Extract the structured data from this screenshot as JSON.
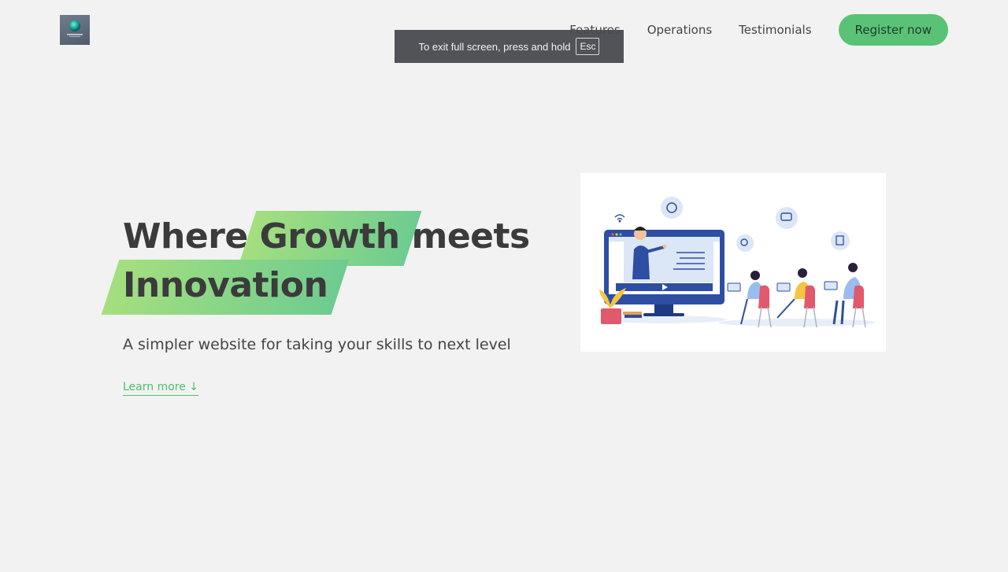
{
  "header": {
    "logo_icon": "globe-logo-icon",
    "nav": [
      {
        "label": "Features"
      },
      {
        "label": "Operations"
      },
      {
        "label": "Testimonials"
      }
    ],
    "register_label": "Register now"
  },
  "fullscreen_notice": {
    "text": "To exit full screen, press and hold",
    "key": "Esc"
  },
  "hero": {
    "title_word_1": "Where",
    "title_highlight_1": "Growth",
    "title_word_2": "meets",
    "title_highlight_2": "Innovation",
    "subtitle": "A simpler website for taking your skills to next level",
    "learn_more": "Learn more ↓"
  },
  "illustration": {
    "icon": "online-class-illustration",
    "colors": {
      "screen": "#2e4ea3",
      "chairs": "#e0596d",
      "plant": "#f5c542",
      "accent_bubbles": "#dbe6f7"
    }
  },
  "colors": {
    "background": "#f2f2f2",
    "accent_green": "#5ac276",
    "highlight_start": "#a5df7f",
    "highlight_end": "#6ecc90",
    "text_dark": "#3b3b3b"
  }
}
